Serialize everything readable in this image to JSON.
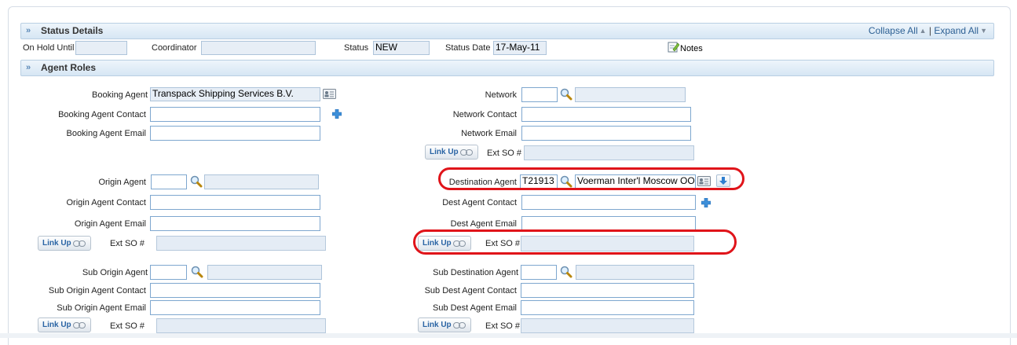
{
  "header": {
    "status_section": "Status Details",
    "collapse_all": "Collapse All",
    "separator": "|",
    "expand_all": "Expand All",
    "agent_section": "Agent Roles"
  },
  "status": {
    "on_hold_label": "On Hold Until",
    "on_hold_value": "",
    "coordinator_label": "Coordinator",
    "coordinator_value": "",
    "status_label": "Status",
    "status_value": "NEW",
    "status_date_label": "Status Date",
    "status_date_value": "17-May-11",
    "notes_label": "Notes"
  },
  "booking": {
    "agent_label": "Booking Agent",
    "agent_value": "Transpack Shipping Services B.V.",
    "contact_label": "Booking Agent Contact",
    "email_label": "Booking Agent Email"
  },
  "network": {
    "label": "Network",
    "contact_label": "Network Contact",
    "email_label": "Network Email",
    "link_up": "Link Up",
    "ext_so_label": "Ext SO #"
  },
  "origin": {
    "agent_label": "Origin Agent",
    "contact_label": "Origin Agent Contact",
    "email_label": "Origin Agent Email",
    "link_up": "Link Up",
    "ext_so_label": "Ext SO #"
  },
  "destination": {
    "agent_label": "Destination Agent",
    "agent_code": "T21913",
    "agent_name": "Voerman Inter'l Moscow OO",
    "contact_label": "Dest Agent Contact",
    "email_label": "Dest Agent Email",
    "link_up": "Link Up",
    "ext_so_label": "Ext SO #"
  },
  "sub_origin": {
    "agent_label": "Sub Origin Agent",
    "contact_label": "Sub Origin Agent Contact",
    "email_label": "Sub Origin Agent Email",
    "link_up": "Link Up",
    "ext_so_label": "Ext SO #"
  },
  "sub_destination": {
    "agent_label": "Sub Destination Agent",
    "contact_label": "Sub Dest Agent Contact",
    "email_label": "Sub Dest Agent Email",
    "link_up": "Link Up",
    "ext_so_label": "Ext SO #"
  },
  "icons": {
    "section": "double-chevron-right-icon",
    "lookup": "magnifier-icon",
    "add": "plus-icon",
    "card": "address-card-icon",
    "download": "down-arrow-icon",
    "chain": "chain-link-icon",
    "notes": "notes-pencil-icon"
  },
  "colors": {
    "highlight_oval": "#e0141a",
    "section_bar": "#d6e6f4",
    "link": "#2a64a4",
    "readonly_field": "#e7eef6"
  }
}
